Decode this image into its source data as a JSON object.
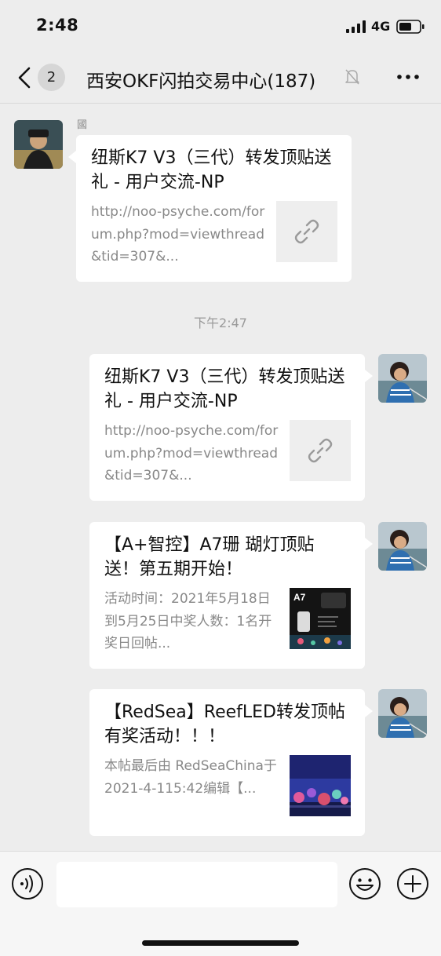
{
  "status_bar": {
    "time": "2:48",
    "network": "4G"
  },
  "nav": {
    "back_icon": "chevron-left-icon",
    "unread_count": "2",
    "title": "西安OKF闪拍交易中心(187)",
    "mute_icon": "bell-slash-icon",
    "more_icon": "ellipsis-icon"
  },
  "messages": [
    {
      "side": "left",
      "sender": "國",
      "title": "纽斯K7 V3（三代）转发顶贴送礼 - 用户交流-NP",
      "desc": "http://noo-psyche.com/forum.php?mod=viewthread&tid=307&...",
      "thumb": "link-icon"
    },
    {
      "side": "right",
      "title": "纽斯K7 V3（三代）转发顶贴送礼 - 用户交流-NP",
      "desc": "http://noo-psyche.com/forum.php?mod=viewthread&tid=307&...",
      "thumb": "link-icon"
    },
    {
      "side": "right",
      "title": "【A+智控】A7珊 瑚灯顶贴送！第五期开始！",
      "desc": "活动时间：2021年5月18日到5月25日中奖人数：1名开奖日回帖...",
      "thumb": "a7-product-image",
      "thumb_label": "A7"
    },
    {
      "side": "right",
      "title": "【RedSea】ReefLED转发顶帖有奖活动！！！",
      "desc": "本帖最后由 RedSeaChina于2021-4-115:42编辑【...",
      "thumb": "aquarium-image"
    }
  ],
  "timestamp": "下午2:47",
  "input_bar": {
    "voice_icon": "voice-icon",
    "emoji_icon": "emoji-icon",
    "plus_icon": "plus-icon",
    "input_value": ""
  },
  "colors": {
    "background": "#ededed",
    "bubble": "#ffffff",
    "secondary_text": "#888888"
  }
}
